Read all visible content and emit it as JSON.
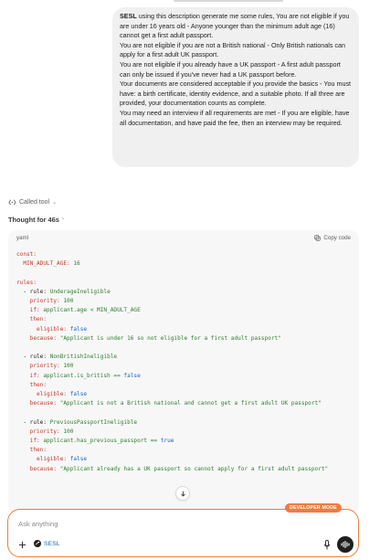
{
  "user_message": {
    "sender": "SESL",
    "intro": " using this description generate me some rules, You are not eligible if you are under 16 years old - Anyone younger than the minimum adult age (16) cannot get a first adult passport.",
    "p2": "You are not eligible if you are not a British national - Only British nationals can apply for a first adult UK passport.",
    "p3": "You are not eligible if you already have a UK passport - A first adult passport can only be issued if you've never had a UK passport before.",
    "p4": "Your documents are considered acceptable if you provide the basics - You must have: a birth certificate, identity evidence, and a suitable photo. If all three are provided, your documentation counts as complete.",
    "p5": "You may need an interview if all requirements are met - If you are eligible, have all documentation, and have paid the fee, then an interview may be required."
  },
  "tool_status": {
    "label": "Called tool"
  },
  "thought": {
    "label": "Thought for 46s"
  },
  "code": {
    "language": "yaml",
    "copy_label": "Copy code",
    "lines": {
      "l1": "const:",
      "l2_key": "  MIN_ADULT_AGE:",
      "l2_val": " 16",
      "l4": "rules:",
      "r1_rule_key": "  - rule:",
      "r1_rule_val": " UnderageIneligible",
      "r1_pri_key": "    priority:",
      "r1_pri_val": " 100",
      "r1_if_key": "    if:",
      "r1_if_val": " applicant.age < MIN_ADULT_AGE",
      "r1_then": "    then:",
      "r1_elig_key": "      eligible:",
      "r1_elig_val": " false",
      "r1_bec_key": "    because:",
      "r1_bec_val": " \"Applicant is under 16 so not eligible for a first adult passport\"",
      "r2_rule_key": "  - rule:",
      "r2_rule_val": " NonBritishIneligible",
      "r2_pri_key": "    priority:",
      "r2_pri_val": " 100",
      "r2_if_key": "    if:",
      "r2_if_val": " applicant.is_british == ",
      "r2_if_bool": "false",
      "r2_then": "    then:",
      "r2_elig_key": "      eligible:",
      "r2_elig_val": " false",
      "r2_bec_key": "    because:",
      "r2_bec_val": " \"Applicant is not a British national and cannot get a first adult UK passport\"",
      "r3_rule_key": "  - rule:",
      "r3_rule_val": " PreviousPassportIneligible",
      "r3_pri_key": "    priority:",
      "r3_pri_val": " 100",
      "r3_if_key": "    if:",
      "r3_if_val": " applicant.has_previous_passport == ",
      "r3_if_bool": "true",
      "r3_then": "    then:",
      "r3_elig_key": "      eligible:",
      "r3_elig_val": " false",
      "r3_bec_key": "    because:",
      "r3_bec_val": " \"Applicant already has a UK passport so cannot apply for a first adult passport\""
    }
  },
  "badge": {
    "label": "DEVELOPER MODE"
  },
  "composer": {
    "placeholder": "Ask anything",
    "gpt_name": "SESL"
  },
  "colors": {
    "accent": "#f07c3e",
    "keyword": "#c0392b",
    "string": "#2e7d32",
    "boolean": "#1565c0"
  }
}
